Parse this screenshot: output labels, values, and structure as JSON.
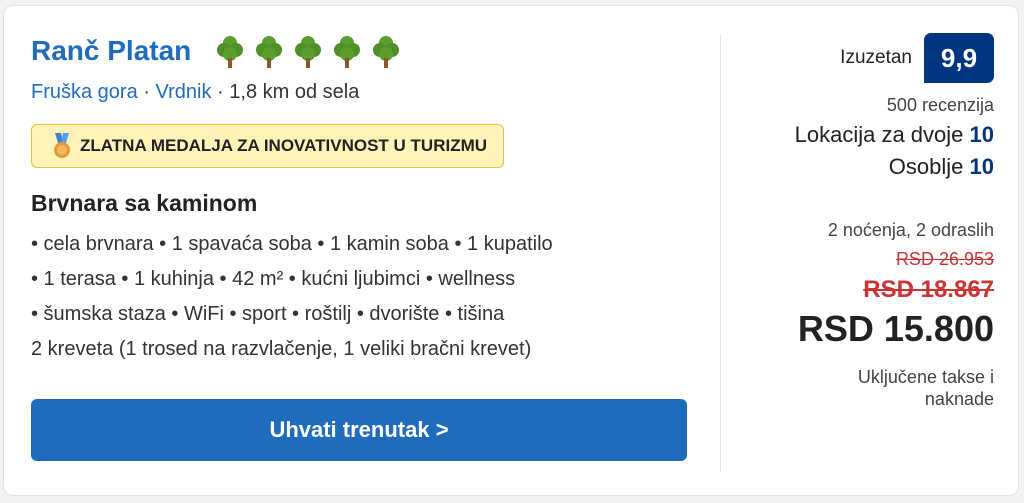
{
  "property": {
    "name": "Ranč Platan",
    "tree_icons": [
      "tree-icon",
      "tree-icon",
      "tree-icon",
      "tree-icon",
      "tree-icon"
    ],
    "region_link": "Fruška gora",
    "town_link": "Vrdnik",
    "separator": "·",
    "distance": "1,8 km od sela",
    "badge_icon": "medal-icon",
    "badge_text": "ZLATNA MEDALJA ZA INOVATIVNOST U TURIZMU"
  },
  "room": {
    "title": "Brvnara sa kaminom",
    "amenity_lines": [
      "• cela brvnara • 1 spavaća soba • 1 kamin soba • 1 kupatilo",
      "• 1 terasa • 1 kuhinja • 42 m² • kućni ljubimci • wellness",
      "• šumska staza • WiFi • sport • roštilj • dvorište • tišina"
    ],
    "beds": "2 kreveta (1 trosed na razvlačenje, 1 veliki bračni krevet)"
  },
  "cta": {
    "label": "Uhvati trenutak >"
  },
  "rating": {
    "word": "Izuzetan",
    "score": "9,9",
    "reviews": "500 recenzija",
    "sub1_label": "Lokacija za dvoje",
    "sub1_value": "10",
    "sub2_label": "Osoblje",
    "sub2_value": "10"
  },
  "pricing": {
    "stay": "2 noćenja, 2 odraslih",
    "old_price_1": "RSD 26.953",
    "old_price_2": "RSD 18.867",
    "price": "RSD 15.800",
    "taxes_line1": "Uključene takse i",
    "taxes_line2": "naknade"
  },
  "colors": {
    "brand_blue": "#1f6cbd",
    "score_navy": "#003580",
    "strike_red": "#cc3333",
    "badge_yellow": "#fff3b8",
    "tree_green": "#5a9e2f"
  }
}
